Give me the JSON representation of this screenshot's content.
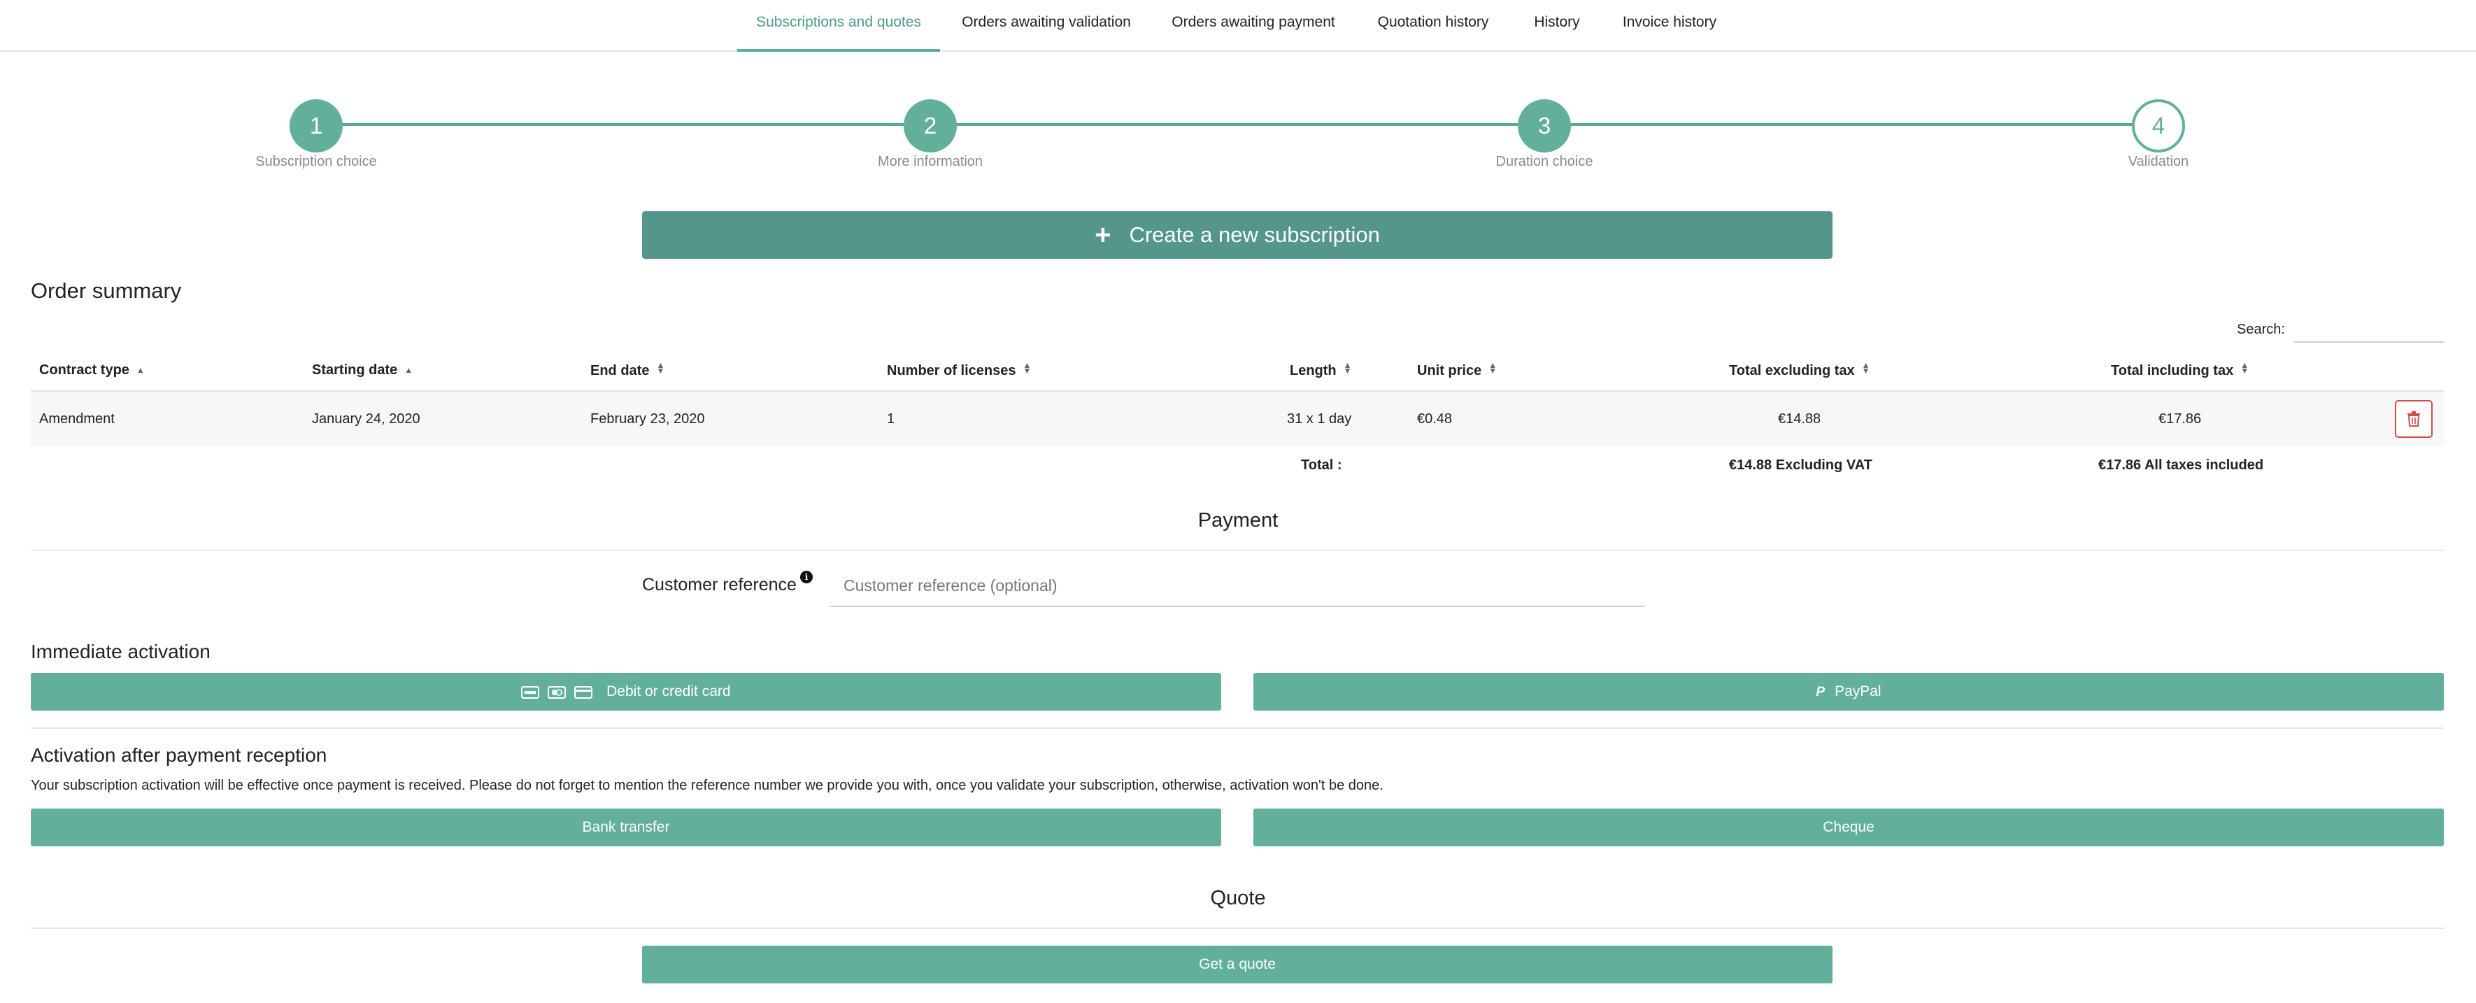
{
  "tabs": [
    {
      "label": "Subscriptions and quotes",
      "active": true
    },
    {
      "label": "Orders awaiting validation"
    },
    {
      "label": "Orders awaiting payment"
    },
    {
      "label": "Quotation history"
    },
    {
      "label": "History"
    },
    {
      "label": "Invoice history"
    }
  ],
  "stepper": {
    "steps": [
      {
        "number": "1",
        "label": "Subscription choice"
      },
      {
        "number": "2",
        "label": "More information"
      },
      {
        "number": "3",
        "label": "Duration choice"
      },
      {
        "number": "4",
        "label": "Validation"
      }
    ]
  },
  "create_button": {
    "icon": "plus-icon",
    "label": "Create a new subscription"
  },
  "order_summary": {
    "title": "Order summary",
    "search_label": "Search:",
    "columns": [
      "Contract type",
      "Starting date",
      "End date",
      "Number of licenses",
      "Length",
      "Unit price",
      "Total excluding tax",
      "Total including tax"
    ],
    "rows": [
      {
        "contract_type": "Amendment",
        "starting_date": "January 24, 2020",
        "end_date": "February 23, 2020",
        "licenses": "1",
        "length": "31 x 1 day",
        "unit_price": "€0.48",
        "total_excl": "€14.88",
        "total_incl": "€17.86"
      }
    ],
    "totals": {
      "label": "Total :",
      "excluding": "€14.88 Excluding VAT",
      "including": "€17.86 All taxes included"
    }
  },
  "payment": {
    "title": "Payment",
    "customer_reference_label": "Customer reference",
    "customer_reference_placeholder": "Customer reference (optional)",
    "customer_reference_value": ""
  },
  "immediate_activation": {
    "title": "Immediate activation",
    "card_button": "Debit or credit card",
    "paypal_button": "PayPal"
  },
  "deferred_activation": {
    "title": "Activation after payment reception",
    "note": "Your subscription activation will be effective once payment is received. Please do not forget to mention the reference number we provide you with, once you validate your subscription, otherwise, activation won't be done.",
    "bank_transfer_button": "Bank transfer",
    "cheque_button": "Cheque"
  },
  "quote": {
    "title": "Quote",
    "button": "Get a quote"
  },
  "colors": {
    "accent": "#5aa997",
    "button": "#62b09c",
    "create_button": "#54978a",
    "danger": "#d64a4a"
  }
}
